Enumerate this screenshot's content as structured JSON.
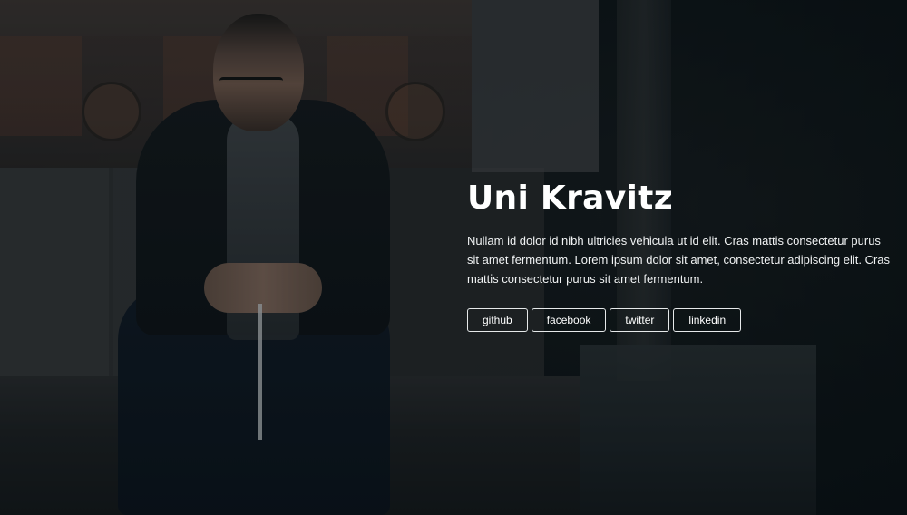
{
  "profile": {
    "name": "Uni Kravitz",
    "bio": "Nullam id dolor id nibh ultricies vehicula ut id elit. Cras mattis consectetur purus sit amet fermentum. Lorem ipsum dolor sit amet, consectetur adipiscing elit. Cras mattis consectetur purus sit amet fermentum."
  },
  "social_links": [
    {
      "label": "github",
      "icon": "none"
    },
    {
      "label": "facebook",
      "icon": "none"
    },
    {
      "label": "twitter",
      "icon": "none"
    },
    {
      "label": "linkedin",
      "icon": "none"
    }
  ],
  "colors": {
    "text": "#ffffff",
    "button_border": "#e6e9ea",
    "background_dark": "#0b1216"
  }
}
